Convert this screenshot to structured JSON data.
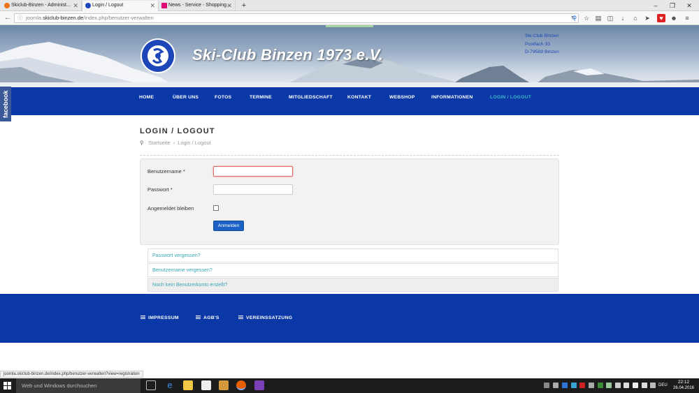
{
  "browser": {
    "tabs": [
      {
        "label": "Skiclub-Binzen - Administ...",
        "active": false
      },
      {
        "label": "Login / Logout",
        "active": true
      },
      {
        "label": "News - Service - Shopping...",
        "active": false
      }
    ],
    "url_prefix": "joomla.",
    "url_domain": "skiclub-binzen.de",
    "url_path": "/index.php/benutzer-verwalten",
    "status_url": "joomla.skiclub-binzen.de/index.php/benutzer-verwalten?view=registration"
  },
  "header": {
    "site_title": "Ski-Club Binzen 1973 e.V.",
    "address_lines": [
      "Ski-Club Binzen",
      "Postfach 33",
      "D-79589 Binzen"
    ],
    "facebook_label": "facebook"
  },
  "menu": {
    "items": [
      "HOME",
      "ÜBER UNS",
      "FOTOS",
      "TERMINE",
      "MITGLIEDSCHAFT",
      "KONTAKT",
      "WEBSHOP",
      "INFORMATIONEN",
      "LOGIN / LOGOUT"
    ],
    "active_index": 8,
    "active_color": "#3fb8c8",
    "bar_color": "#0a38a6"
  },
  "page": {
    "title": "LOGIN / LOGOUT",
    "breadcrumb": [
      "Startseite",
      "Login / Logout"
    ]
  },
  "login_form": {
    "username_label": "Benutzername *",
    "username_value": "",
    "password_label": "Passwort *",
    "password_value": "",
    "remember_label": "Angemeldet bleiben",
    "remember_checked": false,
    "submit_label": "Anmelden"
  },
  "links": [
    "Passwort vergessen?",
    "Benutzername vergessen?",
    "Noch kein Benutzerkonto erstellt?"
  ],
  "footer": {
    "items": [
      "IMPRESSUM",
      "AGB'S",
      "VEREINSSATZUNG"
    ]
  },
  "taskbar": {
    "search_placeholder": "Web und Windows durchsuchen",
    "language": "DEU",
    "time": "22:12",
    "date": "26.04.2016"
  }
}
